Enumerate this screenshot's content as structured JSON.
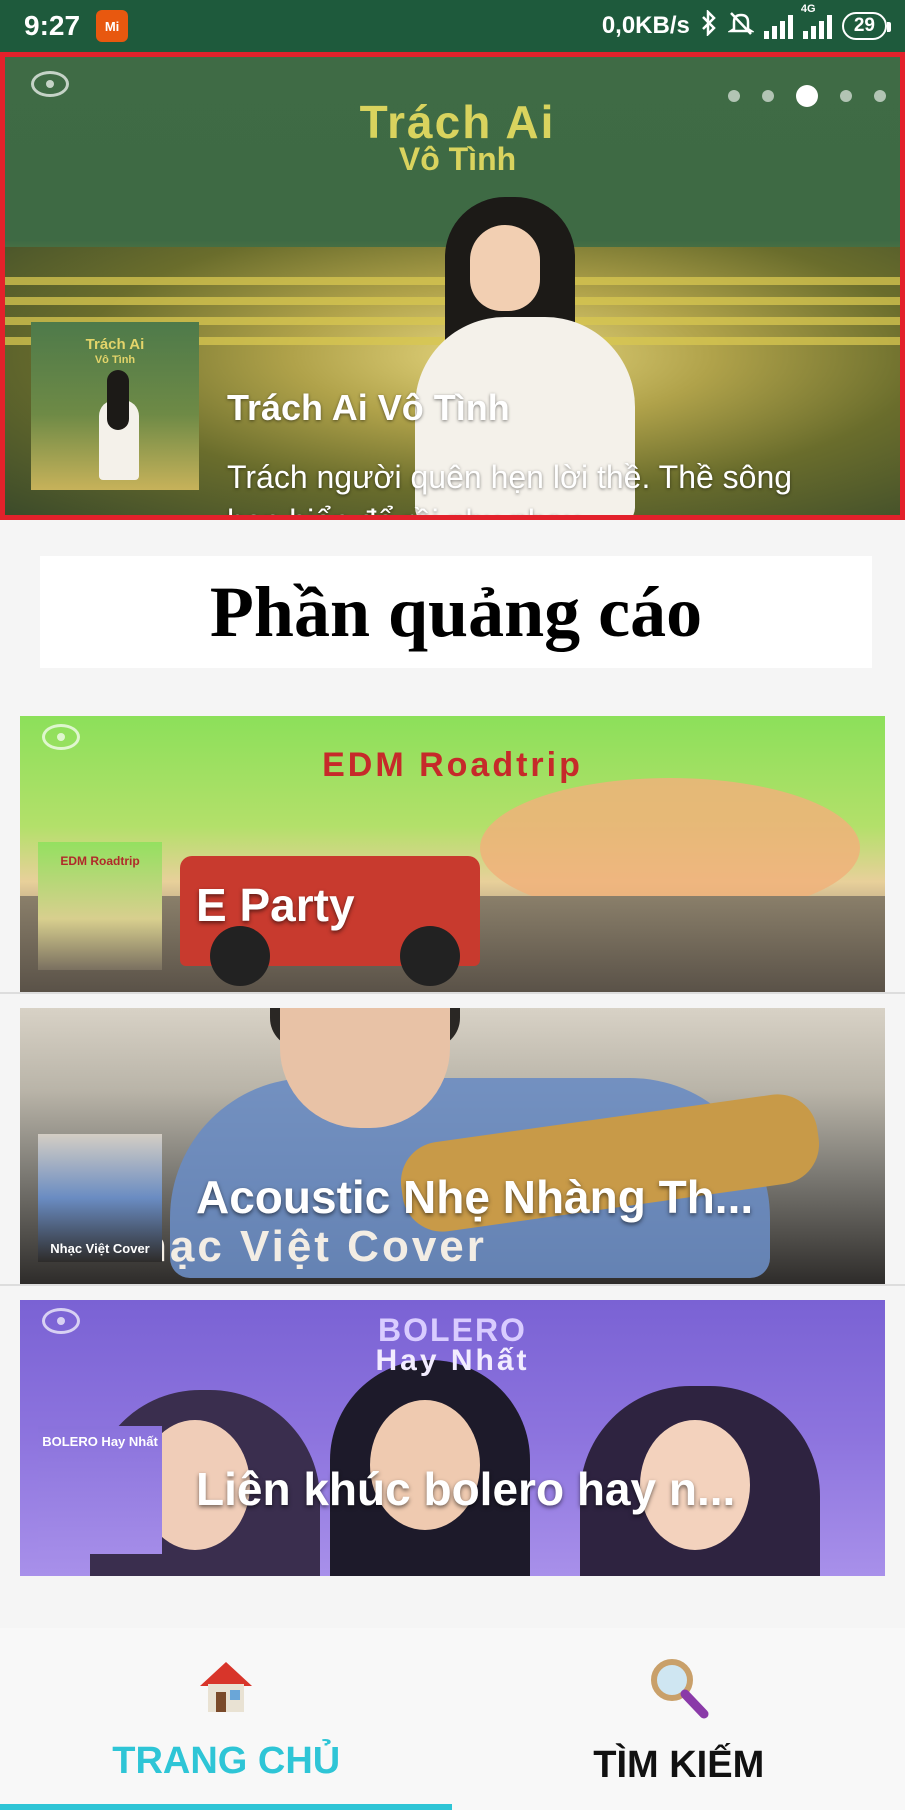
{
  "status_bar": {
    "time": "9:27",
    "app_badge": "Mi",
    "network_speed": "0,0KB/s",
    "network_type": "4G",
    "battery": "29"
  },
  "banner": {
    "art_title_line1": "Trách Ai",
    "art_title_line2": "Vô Tình",
    "thumb_line1": "Trách Ai",
    "thumb_line2": "Vô Tình",
    "name": "Trách Ai Vô Tình",
    "description": "Trách người quên hẹn lời thề. Thề sông hẹn biển để rồi phụ nhau",
    "page_count": 5,
    "active_page": 3
  },
  "ad": {
    "label": "Phần quảng cáo"
  },
  "playlists": [
    {
      "title": "E Party",
      "art_text": "EDM Roadtrip",
      "thumb_text": "EDM Roadtrip"
    },
    {
      "title": "Acoustic Nhẹ Nhàng Th...",
      "art_text": "hạc Việt Cover",
      "thumb_text": "Nhạc Việt Cover"
    },
    {
      "title": "Liên khúc bolero hay n...",
      "art_text_line1": "BOLERO",
      "art_text_line2": "Hay Nhất",
      "thumb_text": "BOLERO Hay Nhất"
    }
  ],
  "bottom_nav": {
    "home_label": "TRANG CHỦ",
    "search_label": "TÌM KIẾM",
    "home_icon": "home-icon",
    "search_icon": "search-icon",
    "active_color": "#2ec5d6"
  },
  "colors": {
    "status_bar": "#1e5a3c",
    "banner_border": "#e3212b",
    "accent": "#2ec5d6"
  }
}
